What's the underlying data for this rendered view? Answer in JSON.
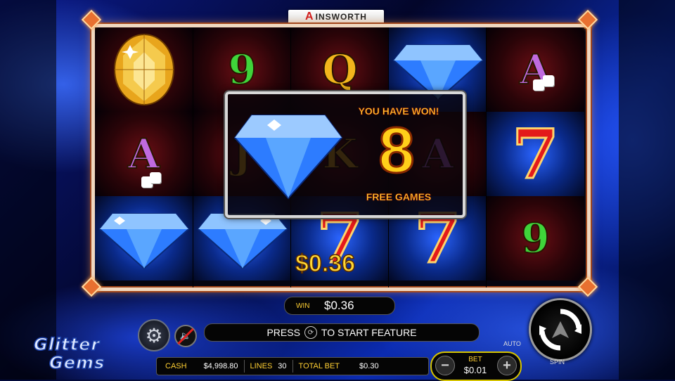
{
  "brand": {
    "name": "INSWORTH",
    "mark": "A"
  },
  "game_title": {
    "line1": "Glitter",
    "line2": "Gems"
  },
  "reels": [
    [
      "gem-gold",
      "A",
      "gem-blue"
    ],
    [
      "9",
      "J",
      "gem-blue"
    ],
    [
      "Q",
      "K",
      "7"
    ],
    [
      "gem-blue",
      "A",
      "7"
    ],
    [
      "A",
      "7",
      "9"
    ]
  ],
  "win_overlay": {
    "title": "YOU HAVE WON!",
    "count": "8",
    "subtitle": "FREE GAMES"
  },
  "line_win_amount": "$0.36",
  "win": {
    "label": "WIN",
    "value": "$0.36"
  },
  "prompt": {
    "before": "PRESS",
    "after": "TO START FEATURE"
  },
  "info": {
    "cash_label": "CASH",
    "cash_value": "$4,998.80",
    "lines_label": "LINES",
    "lines_value": "30",
    "total_bet_label": "TOTAL BET",
    "total_bet_value": "$0.30"
  },
  "bet": {
    "label": "BET",
    "value": "$0.01",
    "minus": "−",
    "plus": "+"
  },
  "auto_label": "AUTO",
  "spin_label": "SPIN",
  "colors": {
    "accent_gold": "#ffcf33",
    "frame": "#f0d8c0",
    "bet_border": "#d6c400"
  }
}
